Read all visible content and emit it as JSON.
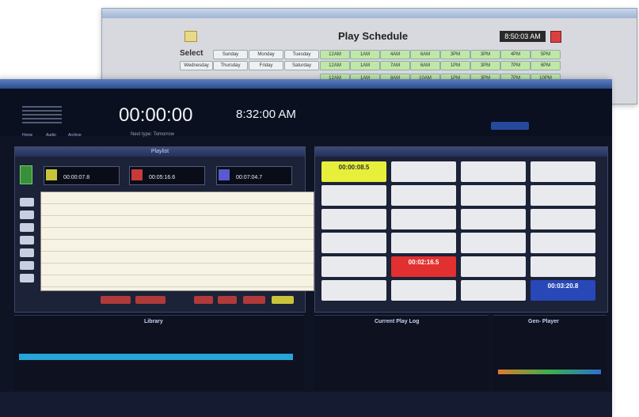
{
  "background_window": {
    "title": "Play Schedule",
    "select_label": "Select",
    "clock": "8:50:03 AM",
    "day_cells": [
      "Sunday",
      "Monday",
      "Tuesday"
    ],
    "day_label": "Wednesday",
    "day_cells2": [
      "Thursday",
      "Friday",
      "Saturday"
    ],
    "hour_cells": [
      "12AM",
      "1AM",
      "4AM",
      "6AM",
      "3PM",
      "3PM",
      "4PM",
      "5PM"
    ],
    "hour_cells2": [
      "12AM",
      "1AM",
      "7AM",
      "6AM",
      "1PM",
      "3PM",
      "7PM",
      "6PM"
    ],
    "hour_cells3": [
      "12AM",
      "1AM",
      "8AM",
      "10AM",
      "1PM",
      "3PM",
      "7PM",
      "10PM"
    ]
  },
  "header": {
    "timer": "00:00:00",
    "clock": "8:32:00 AM",
    "timer_caption": "Next type: Tomorrow",
    "clock_caption": "",
    "tabs": [
      "Home",
      "Audio",
      "Archive"
    ],
    "right_label": ""
  },
  "playlist": {
    "title": "Playlist",
    "players": [
      {
        "label": "",
        "time": "00:00:07.8",
        "color": "#c8c43a"
      },
      {
        "label": "",
        "time": "00:05:16.6",
        "color": "#c83a3a"
      },
      {
        "label": "",
        "time": "00:07:04.7",
        "color": "#5a5ad0"
      }
    ],
    "buttons": [
      "",
      "",
      "",
      "",
      "",
      ""
    ]
  },
  "cartwall": {
    "title": "",
    "carts": [
      {
        "id": "",
        "time": "00:00:08.5",
        "bg": "#e7ef3a"
      },
      {
        "id": "",
        "time": "",
        "bg": "#e9eaee"
      },
      {
        "id": "",
        "time": "",
        "bg": "#e9eaee"
      },
      {
        "id": "",
        "time": "",
        "bg": "#e9eaee"
      },
      {
        "id": "",
        "time": "",
        "bg": "#e9eaee"
      },
      {
        "id": "",
        "time": "",
        "bg": "#e9eaee"
      },
      {
        "id": "",
        "time": "",
        "bg": "#e9eaee"
      },
      {
        "id": "",
        "time": "",
        "bg": "#e9eaee"
      },
      {
        "id": "",
        "time": "",
        "bg": "#e9eaee"
      },
      {
        "id": "",
        "time": "",
        "bg": "#e9eaee"
      },
      {
        "id": "",
        "time": "",
        "bg": "#e9eaee"
      },
      {
        "id": "",
        "time": "",
        "bg": "#e9eaee"
      },
      {
        "id": "",
        "time": "",
        "bg": "#e9eaee"
      },
      {
        "id": "",
        "time": "",
        "bg": "#e9eaee"
      },
      {
        "id": "",
        "time": "",
        "bg": "#e9eaee"
      },
      {
        "id": "",
        "time": "",
        "bg": "#e9eaee"
      },
      {
        "id": "",
        "time": "",
        "bg": "#e9eaee"
      },
      {
        "id": "",
        "time": "00:02:16.5",
        "bg": "#e23030"
      },
      {
        "id": "",
        "time": "",
        "bg": "#e9eaee"
      },
      {
        "id": "",
        "time": "",
        "bg": "#e9eaee"
      },
      {
        "id": "",
        "time": "",
        "bg": "#e9eaee"
      },
      {
        "id": "",
        "time": "",
        "bg": "#e9eaee"
      },
      {
        "id": "",
        "time": "",
        "bg": "#e9eaee"
      },
      {
        "id": "",
        "time": "00:03:20.8",
        "bg": "#2848b8"
      }
    ]
  },
  "bottom": {
    "library_title": "Library",
    "playlog_title": "Current Play Log",
    "player_title": "Gen- Player"
  },
  "status": {
    "message": ""
  }
}
